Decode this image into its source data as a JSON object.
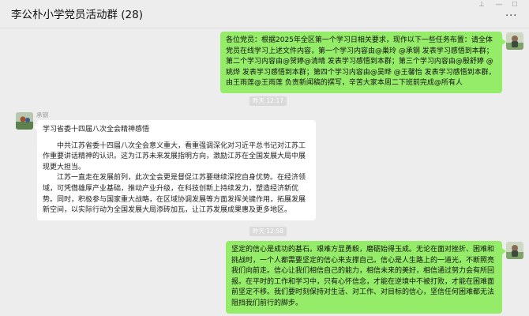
{
  "header": {
    "title": "李公朴小学党员活动群 (28)",
    "more_icon": "more-dots-icon",
    "window_controls": [
      "pin-icon",
      "minimize-icon",
      "maximize-icon"
    ]
  },
  "messages": {
    "m1": {
      "text": "各位党员：根据2025年全区第一个学习日相关要求，现作以下一些任务布置：请全体党员在线学习上述文件内容，第一个学习内容由@巢玲 @承钢 发表学习感悟到本群；第二个学习内容由@贺婷@清晴 发表学习感悟到本群；第三个学习内容由@殷舒婷 @姚烨 发表学习感悟到本群；第四个学习内容由@吴晔 @王馨怡 发表学习感悟到本群，由王雨莲@王雨莲 负责新闻稿的撰写，辛苦大家本周二下班前完成@所有人"
    },
    "time1": "昨天 12:17",
    "m2": {
      "sender": "承钢",
      "title": "学习省委十四届八次全会精神感悟",
      "para1": "中共江苏省委十四届八次全会意义重大，看重强调深化对习近平总书记对江苏工作重要讲话精神的认识。这为江苏未来发展指明方向，激励江苏在全国发展大局中展现更大担当。",
      "para2": "江苏一直走在发展前列，此次全会更是督促江苏要继续深挖自身优势。在经济领域，可凭借雄厚产业基础，推动产业升级，在科技创新上持续发力，塑造经济新优势。同时，积极参与国家重大战略，在区域协调发展等方面发挥关键作用，拓展发展新空间，以实际行动为全国发展大局添砖加瓦，让江苏发展成果惠及更多地区。"
    },
    "time2": "昨天 12:58",
    "m3": {
      "text": "坚定的信心是成功的基石。艰难方显勇毅，磨砺始得玉成。无论在面对挫折、困难和挑战时，一个人都需要坚定的信心来支撑自己。信心是人生路上的一道光，不断照亮我们向前走。信心让我们相信自己的能力，相信未来的美好，相信通过努力会有所回报。在平时的工作和学习中，只有心怀信念，才能在逆境中不被打败，才能在困难面前坚定不移。我们要时刻保持对生活、对工作、对目标的信心，坚信任何困难都无法阻挡我们前行的脚步。"
    }
  },
  "colors": {
    "background": "#ededed",
    "self_bubble": "#95ec69",
    "other_bubble": "#ffffff",
    "time_tag": "#dadada"
  }
}
